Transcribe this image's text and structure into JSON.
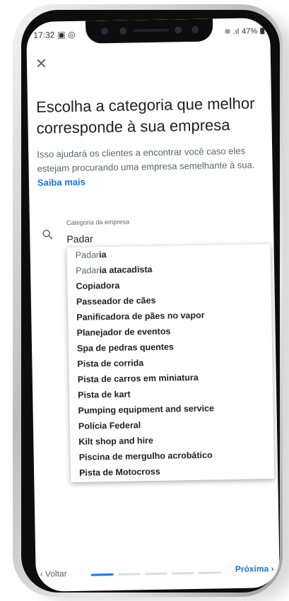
{
  "status_bar": {
    "time": "17:32",
    "left_icons": "▣ ◎",
    "right_icons": "≋ .ıl",
    "battery": "47%"
  },
  "icons": {
    "close": "close-icon",
    "search": "search-icon",
    "back": "chevron-left-icon",
    "next": "chevron-right-icon"
  },
  "page": {
    "title": "Escolha a categoria que melhor corresponde à sua empresa",
    "description": "Isso ajudará os clientes a encontrar você caso eles estejam procurando uma empresa semelhante à sua.",
    "learn_more": "Saiba mais"
  },
  "search": {
    "label": "Categoria da empresa",
    "value": "Padar"
  },
  "suggestions": [
    {
      "typed": "Padar",
      "rest": "ia"
    },
    {
      "typed": "Padar",
      "rest": "ia atacadista"
    },
    {
      "typed": "",
      "rest": "Copiadora"
    },
    {
      "typed": "",
      "rest": "Passeador de cães"
    },
    {
      "typed": "",
      "rest": "Panificadora de pães no vapor"
    },
    {
      "typed": "",
      "rest": "Planejador de eventos"
    },
    {
      "typed": "",
      "rest": "Spa de pedras quentes"
    },
    {
      "typed": "",
      "rest": "Pista de corrida"
    },
    {
      "typed": "",
      "rest": "Pista de carros em miniatura"
    },
    {
      "typed": "",
      "rest": "Pista de kart"
    },
    {
      "typed": "",
      "rest": "Pumping equipment and service"
    },
    {
      "typed": "",
      "rest": "Polícia Federal"
    },
    {
      "typed": "",
      "rest": "Kilt shop and hire"
    },
    {
      "typed": "",
      "rest": "Piscina de mergulho acrobático"
    },
    {
      "typed": "",
      "rest": "Pista de Motocross"
    }
  ],
  "footer": {
    "back_label": "Voltar",
    "next_label": "Próxima",
    "progress_current": 1,
    "progress_total": 5
  },
  "colors": {
    "accent": "#1a73e8",
    "text_primary": "#202124",
    "text_secondary": "#5f6368"
  }
}
